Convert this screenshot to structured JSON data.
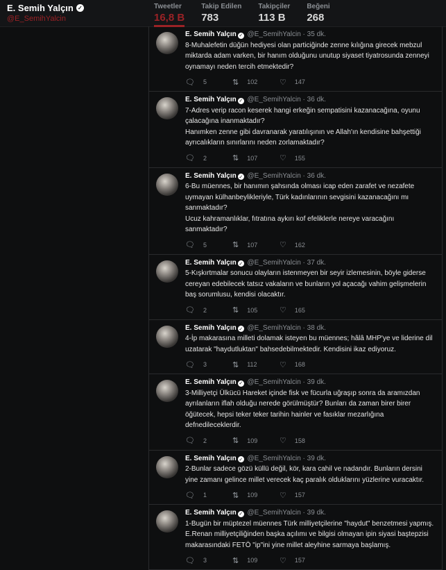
{
  "profile": {
    "name": "E. Semih Yalçın",
    "handle": "@E_SemihYalcin"
  },
  "stats": [
    {
      "label": "Tweetler",
      "value": "16,8 B"
    },
    {
      "label": "Takip Edilen",
      "value": "783"
    },
    {
      "label": "Takipçiler",
      "value": "113 B"
    },
    {
      "label": "Beğeni",
      "value": "268"
    }
  ],
  "icons": {
    "reply": "reply-icon",
    "retweet": "retweet-icon",
    "like": "heart-icon",
    "verified": "verified-badge-icon"
  },
  "colors": {
    "accent": "#9b2226",
    "background": "#0e0f10"
  },
  "tweets": [
    {
      "name": "E. Semih Yalçın",
      "handle": "@E_SemihYalcin",
      "sep": "·",
      "time": "35 dk.",
      "text": "8-Muhalefetin düğün hediyesi olan particiğinde zenne kılığına girecek mebzul miktarda adam varken, bir hanım olduğunu unutup siyaset tiyatrosunda zenneyi oynamayı neden tercih etmektedir?",
      "replies": "5",
      "retweets": "102",
      "likes": "147"
    },
    {
      "name": "E. Semih Yalçın",
      "handle": "@E_SemihYalcin",
      "sep": "·",
      "time": "36 dk.",
      "text": "7-Adres verip racon keserek hangi erkeğin sempatisini kazanacağına, oyunu çalacağına inanmaktadır?\nHanımken zenne gibi davranarak yaratılışının ve Allah'ın kendisine bahşettiği ayrıcalıkların sınırlarını neden zorlamaktadır?",
      "replies": "2",
      "retweets": "107",
      "likes": "155"
    },
    {
      "name": "E. Semih Yalçın",
      "handle": "@E_SemihYalcin",
      "sep": "·",
      "time": "36 dk.",
      "text": "6-Bu müennes, bir hanımın şahsında olması icap eden zarafet ve nezafete uymayan külhanbeylikleriyle, Türk kadınlarının sevgisini kazanacağını mı sanmaktadır?\nUcuz kahramanlıklar, fıtratına aykırı kof efeliklerle nereye varacağını sanmaktadır?",
      "replies": "5",
      "retweets": "107",
      "likes": "162"
    },
    {
      "name": "E. Semih Yalçın",
      "handle": "@E_SemihYalcin",
      "sep": "·",
      "time": "37 dk.",
      "text": "5-Kışkırtmalar sonucu olayların istenmeyen bir seyir izlemesinin, böyle giderse cereyan edebilecek tatsız vakaların ve bunların yol açacağı vahim gelişmelerin baş sorumlusu, kendisi olacaktır.",
      "replies": "2",
      "retweets": "105",
      "likes": "165"
    },
    {
      "name": "E. Semih Yalçın",
      "handle": "@E_SemihYalcin",
      "sep": "·",
      "time": "38 dk.",
      "text": "4-İp makarasına milleti dolamak isteyen bu müennes; hâlâ MHP'ye ve liderine dil uzatarak \"haydutluktan\" bahsedebilmektedir. Kendisini ikaz ediyoruz.",
      "replies": "3",
      "retweets": "112",
      "likes": "168"
    },
    {
      "name": "E. Semih Yalçın",
      "handle": "@E_SemihYalcin",
      "sep": "·",
      "time": "39 dk.",
      "text": "3-Milliyetçi Ülkücü Hareket içinde fisk ve fücurla uğraşıp sonra da aramızdan ayrılanların iflah olduğu nerede görülmüştür? Bunları da zaman birer birer öğütecek, hepsi teker teker tarihin hainler ve fasıklar mezarlığına defnedileceklerdir.",
      "replies": "2",
      "retweets": "109",
      "likes": "158"
    },
    {
      "name": "E. Semih Yalçın",
      "handle": "@E_SemihYalcin",
      "sep": "·",
      "time": "39 dk.",
      "text": "2-Bunlar sadece gözü küllü değil, kör, kara cahil ve nadandır. Bunların dersini yine zamanı gelince millet verecek kaç paralık olduklarını yüzlerine vuracaktır.",
      "replies": "1",
      "retweets": "109",
      "likes": "157"
    },
    {
      "name": "E. Semih Yalçın",
      "handle": "@E_SemihYalcin",
      "sep": "·",
      "time": "39 dk.",
      "text": "1-Bugün bir müptezel müennes Türk milliyetçilerine \"haydut\" benzetmesi yapmış. E.Renan milliyetçiliğinden başka açılımı ve bilgisi olmayan ipin siyasi baştерzisi makarasındaki FETÖ \"ip\"ini yine millet aleyhine sarmaya başlamış.",
      "replies": "3",
      "retweets": "109",
      "likes": "157"
    }
  ]
}
